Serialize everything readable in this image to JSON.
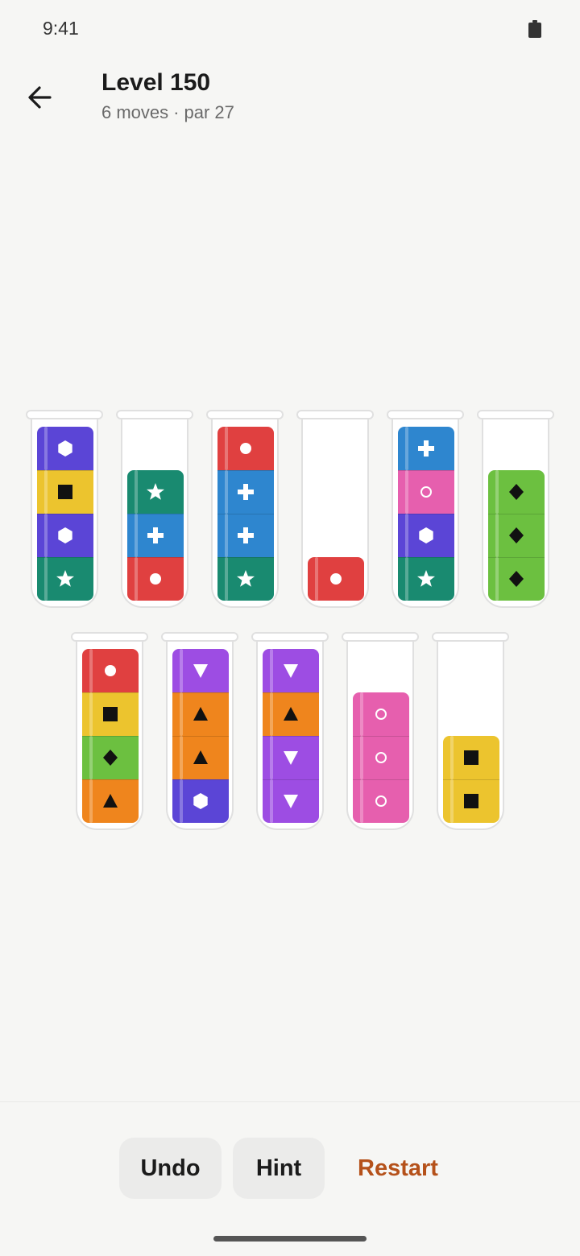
{
  "status_bar": {
    "time": "9:41",
    "battery_icon": "battery-full-icon"
  },
  "header": {
    "back_icon": "arrow-left-icon",
    "title": "Level 150",
    "moves": "6 moves",
    "separator": "·",
    "par": "par 27"
  },
  "colors": {
    "purple": "#5b45d6",
    "yellow": "#ecc42e",
    "teal": "#198a70",
    "red": "#e04040",
    "blue": "#2e86cf",
    "pink": "#e65fae",
    "green": "#6cc040",
    "orange": "#ef851d",
    "violet": "#9d4de3",
    "restart_text": "#b5511a"
  },
  "tube_capacity": 4,
  "tubes": [
    {
      "row": 1,
      "blocks": [
        {
          "color": "purple",
          "symbol": "hexagon"
        },
        {
          "color": "yellow",
          "symbol": "square"
        },
        {
          "color": "purple",
          "symbol": "hexagon"
        },
        {
          "color": "teal",
          "symbol": "star"
        }
      ]
    },
    {
      "row": 1,
      "blocks": [
        {
          "color": "teal",
          "symbol": "star"
        },
        {
          "color": "blue",
          "symbol": "plus"
        },
        {
          "color": "red",
          "symbol": "circle"
        }
      ]
    },
    {
      "row": 1,
      "blocks": [
        {
          "color": "red",
          "symbol": "circle"
        },
        {
          "color": "blue",
          "symbol": "plus"
        },
        {
          "color": "blue",
          "symbol": "plus"
        },
        {
          "color": "teal",
          "symbol": "star"
        }
      ]
    },
    {
      "row": 1,
      "blocks": [
        {
          "color": "red",
          "symbol": "circle"
        }
      ]
    },
    {
      "row": 1,
      "blocks": [
        {
          "color": "blue",
          "symbol": "plus"
        },
        {
          "color": "pink",
          "symbol": "ring"
        },
        {
          "color": "purple",
          "symbol": "hexagon"
        },
        {
          "color": "teal",
          "symbol": "star"
        }
      ]
    },
    {
      "row": 1,
      "blocks": [
        {
          "color": "green",
          "symbol": "diamond"
        },
        {
          "color": "green",
          "symbol": "diamond"
        },
        {
          "color": "green",
          "symbol": "diamond"
        }
      ]
    },
    {
      "row": 2,
      "blocks": [
        {
          "color": "red",
          "symbol": "circle"
        },
        {
          "color": "yellow",
          "symbol": "square"
        },
        {
          "color": "green",
          "symbol": "diamond"
        },
        {
          "color": "orange",
          "symbol": "triangle-up"
        }
      ]
    },
    {
      "row": 2,
      "blocks": [
        {
          "color": "violet",
          "symbol": "triangle-down"
        },
        {
          "color": "orange",
          "symbol": "triangle-up"
        },
        {
          "color": "orange",
          "symbol": "triangle-up"
        },
        {
          "color": "purple",
          "symbol": "hexagon"
        }
      ]
    },
    {
      "row": 2,
      "blocks": [
        {
          "color": "violet",
          "symbol": "triangle-down"
        },
        {
          "color": "orange",
          "symbol": "triangle-up"
        },
        {
          "color": "violet",
          "symbol": "triangle-down"
        },
        {
          "color": "violet",
          "symbol": "triangle-down"
        }
      ]
    },
    {
      "row": 2,
      "blocks": [
        {
          "color": "pink",
          "symbol": "ring"
        },
        {
          "color": "pink",
          "symbol": "ring"
        },
        {
          "color": "pink",
          "symbol": "ring"
        }
      ]
    },
    {
      "row": 2,
      "blocks": [
        {
          "color": "yellow",
          "symbol": "square"
        },
        {
          "color": "yellow",
          "symbol": "square"
        }
      ]
    }
  ],
  "actions": {
    "undo": "Undo",
    "hint": "Hint",
    "restart": "Restart"
  }
}
